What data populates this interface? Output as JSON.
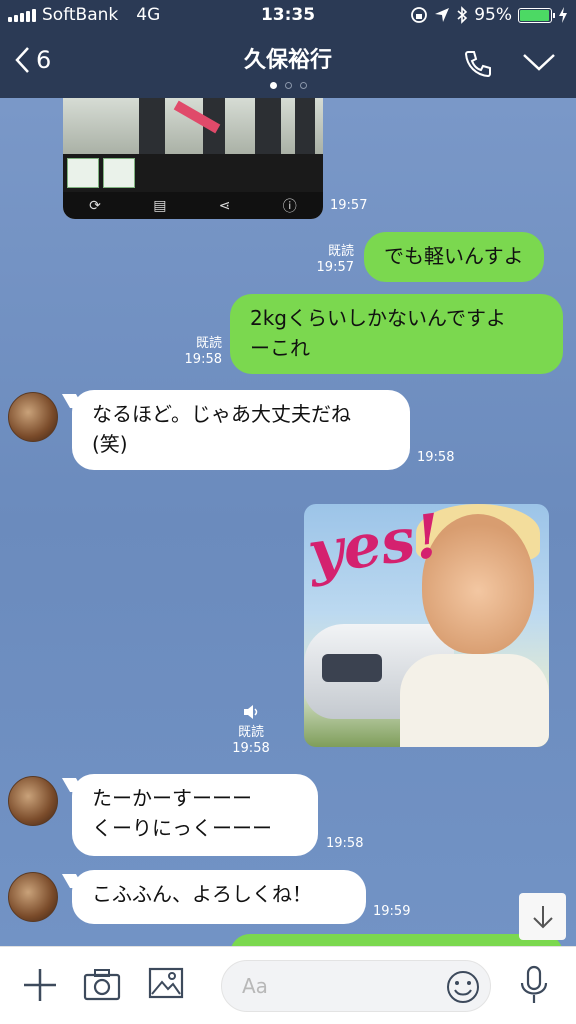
{
  "status": {
    "carrier": "SoftBank",
    "network": "4G",
    "time": "13:35",
    "battery": "95%",
    "battery_level": 0.95
  },
  "header": {
    "back_count": "6",
    "title": "久保裕行"
  },
  "messages": {
    "media_time": "19:57",
    "m1": {
      "read": "既読",
      "time": "19:57",
      "text": "でも軽いんすよ"
    },
    "m2": {
      "read": "既読",
      "time": "19:58",
      "line1": "2kgくらいしかないんですよ",
      "line2": "ーこれ"
    },
    "m3": {
      "time": "19:58",
      "line1": "なるほど。じゃあ大丈夫だね",
      "line2": "(笑)"
    },
    "m4": {
      "read": "既読",
      "time": "19:58",
      "sticker_text": "yes!"
    },
    "m5": {
      "time": "19:58",
      "line1": "たーかーすーーー",
      "line2": "くーりにっくーーー"
    },
    "m6": {
      "time": "19:59",
      "text": "こふふん、よろしくね！"
    }
  },
  "composer": {
    "placeholder": "Aa"
  },
  "colors": {
    "header_bg": "#2b3a55",
    "my_bubble": "#7bd84f",
    "their_bubble": "#ffffff",
    "chat_bg": "#6f8fc0"
  }
}
